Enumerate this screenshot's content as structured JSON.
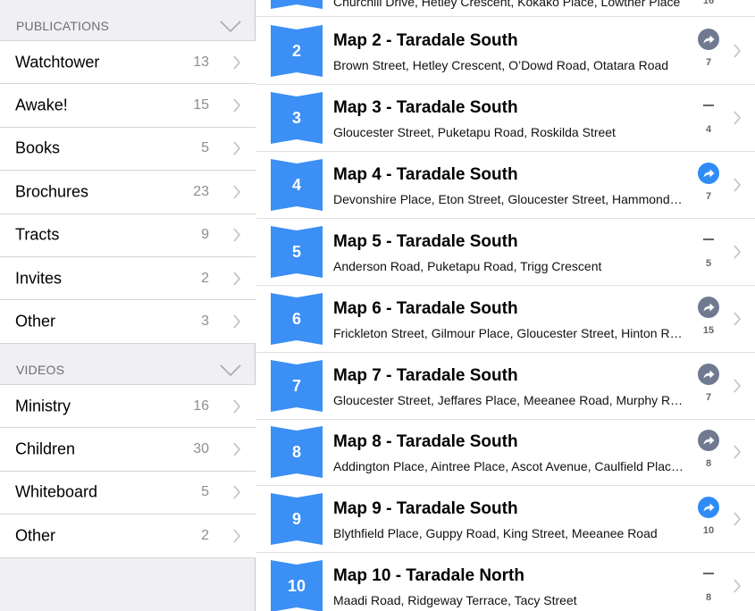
{
  "sidebar": {
    "publications": {
      "header": "PUBLICATIONS",
      "items": [
        {
          "label": "Watchtower",
          "count": "13"
        },
        {
          "label": "Awake!",
          "count": "15"
        },
        {
          "label": "Books",
          "count": "5"
        },
        {
          "label": "Brochures",
          "count": "23"
        },
        {
          "label": "Tracts",
          "count": "9"
        },
        {
          "label": "Invites",
          "count": "2"
        },
        {
          "label": "Other",
          "count": "3"
        }
      ]
    },
    "videos": {
      "header": "VIDEOS",
      "items": [
        {
          "label": "Ministry",
          "count": "16"
        },
        {
          "label": "Children",
          "count": "30"
        },
        {
          "label": "Whiteboard",
          "count": "5"
        },
        {
          "label": "Other",
          "count": "2"
        }
      ]
    }
  },
  "maps": {
    "partial_top": {
      "streets": "Churchill Drive, Hetley Crescent, Kokako Place, Lowther Place",
      "count": "16"
    },
    "items": [
      {
        "number": "2",
        "title": "Map 2 - Taradale South",
        "streets": "Brown Street, Hetley Crescent, O’Dowd Road, Otatara Road",
        "count": "7",
        "status": "share-gray"
      },
      {
        "number": "3",
        "title": "Map 3 - Taradale South",
        "streets": "Gloucester Street, Puketapu Road, Roskilda Street",
        "count": "4",
        "status": "dash"
      },
      {
        "number": "4",
        "title": "Map 4 - Taradale South",
        "streets": "Devonshire Place, Eton Street, Gloucester Street, Hammond…",
        "count": "7",
        "status": "share-blue"
      },
      {
        "number": "5",
        "title": "Map 5 - Taradale South",
        "streets": "Anderson Road, Puketapu Road, Trigg Crescent",
        "count": "5",
        "status": "dash"
      },
      {
        "number": "6",
        "title": "Map 6 - Taradale South",
        "streets": "Frickleton Street, Gilmour Place, Gloucester Street, Hinton Ro…",
        "count": "15",
        "status": "share-gray"
      },
      {
        "number": "7",
        "title": "Map 7 - Taradale South",
        "streets": "Gloucester Street, Jeffares Place, Meeanee Road, Murphy Ro…",
        "count": "7",
        "status": "share-gray"
      },
      {
        "number": "8",
        "title": "Map 8 - Taradale South",
        "streets": "Addington Place, Aintree Place, Ascot Avenue, Caulfield Plac…",
        "count": "8",
        "status": "share-gray"
      },
      {
        "number": "9",
        "title": "Map 9 - Taradale South",
        "streets": "Blythfield Place, Guppy Road, King Street, Meeanee Road",
        "count": "10",
        "status": "share-blue"
      },
      {
        "number": "10",
        "title": "Map 10 - Taradale North",
        "streets": "Maadi Road, Ridgeway Terrace, Tacy Street",
        "count": "8",
        "status": "dash"
      }
    ]
  },
  "colors": {
    "badge": "#3b8ff5",
    "share_blue": "#2f8cf6",
    "share_gray": "#6f7a90"
  }
}
